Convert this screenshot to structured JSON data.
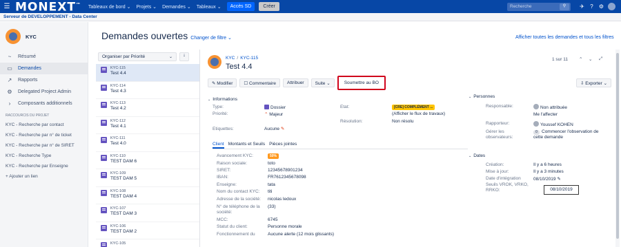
{
  "topbar": {
    "menu_icon": "☰",
    "logo": "MONEXT",
    "nav": [
      "Tableaux de bord ⌄",
      "Projets ⌄",
      "Demandes ⌄",
      "Tableaux ⌄"
    ],
    "acces_sd": "Accès SD",
    "creer": "Créer",
    "search_placeholder": "Recherche",
    "search_icon": "🔍"
  },
  "subbar": {
    "server": "Serveur de DEVELOPPEMENT - Data Center"
  },
  "sidebar": {
    "project_name": "KYC",
    "items": [
      {
        "icon": "~",
        "label": "Résumé"
      },
      {
        "icon": "▭",
        "label": "Demandes"
      },
      {
        "icon": "↗",
        "label": "Rapports"
      },
      {
        "icon": "⚙",
        "label": "Delegated Project Admin"
      },
      {
        "icon": "›",
        "label": "Composants additionnels"
      }
    ],
    "shortcuts_title": "RACCOURCIS DU PROJET",
    "shortcuts": [
      "KYC - Recherche par contact",
      "KYC - Recherche par n° de ticket",
      "KYC - Recherche par n° de SIRET",
      "KYC - Recherche Type",
      "KYC - Recherche par Enseigne"
    ],
    "add_link": "+  Ajouter un lien"
  },
  "header": {
    "title": "Demandes ouvertes",
    "change_filter": "Changer de filtre ⌄",
    "all_requests": "Afficher toutes les demandes et tous les filtres"
  },
  "list": {
    "order_by": "Organiser par Priorité",
    "order_dir": "↓",
    "rows": [
      {
        "key": "KYC-115",
        "title": "Test 4.4"
      },
      {
        "key": "KYC-114",
        "title": "Test 4.3"
      },
      {
        "key": "KYC-113",
        "title": "Test 4.2"
      },
      {
        "key": "KYC-112",
        "title": "Test 4.1"
      },
      {
        "key": "KYC-111",
        "title": "Test 4.0"
      },
      {
        "key": "KYC-110",
        "title": "TEST DAM 6"
      },
      {
        "key": "KYC-109",
        "title": "TEST DAM 5"
      },
      {
        "key": "KYC-108",
        "title": "TEST DAM 4"
      },
      {
        "key": "KYC-107",
        "title": "TEST DAM 3"
      },
      {
        "key": "KYC-106",
        "title": "TEST DAM 2"
      },
      {
        "key": "KYC-105",
        "title": ""
      }
    ]
  },
  "detail": {
    "crumb_project": "KYC",
    "crumb_sep": "/",
    "crumb_key": "KYC-115",
    "title": "Test 4.4",
    "pager": "1 sur 11",
    "toolbar": {
      "modifier": "✎ Modifier",
      "commentaire": "☐ Commentaire",
      "attribuer": "Attribuer",
      "suite": "Suite ⌄",
      "soumettre": "Soumettre au BO"
    },
    "export": "⇩ Exporter ⌄",
    "info": {
      "section": "Informations",
      "type_label": "Type:",
      "type_value": "Dossier",
      "priority_label": "Priorité:",
      "priority_value": "Majeur",
      "labels_label": "Etiquettes:",
      "labels_value": "Aucune",
      "state_label": "Etat:",
      "state_badge": "[CRE] COMPLÉMENT ...",
      "state_flow": "(Afficher le flux de travaux)",
      "resolution_label": "Résolution:",
      "resolution_value": "Non résolu"
    },
    "tabs": [
      "Client",
      "Montants et Seuils",
      "Pièces jointes"
    ],
    "client": [
      {
        "label": "Avancement KYC:",
        "value": "50%"
      },
      {
        "label": "Raison sociale:",
        "value": "toto"
      },
      {
        "label": "SIRET:",
        "value": "12345678901234"
      },
      {
        "label": "IBAN:",
        "value": "FR7612345678098"
      },
      {
        "label": "Enseigne:",
        "value": "tata"
      },
      {
        "label": "Nom du contact KYC:",
        "value": "titi"
      },
      {
        "label": "Adresse de la société:",
        "value": "nicolas ledoux"
      },
      {
        "label": "N° de téléphone de la société:",
        "value": "(33)"
      },
      {
        "label": "MCC:",
        "value": "6745"
      },
      {
        "label": "Statut du client:",
        "value": "Personne morale"
      },
      {
        "label": "Fonctionnement du",
        "value": "Aucune alerte (12 mois glissants)"
      }
    ],
    "people": {
      "section": "Personnes",
      "responsable_label": "Responsable:",
      "responsable_value": "Non attribuée",
      "assign_me": "Me l'affecter",
      "rapporteur_label": "Rapporteur:",
      "rapporteur_value": "Youssef KOHEN",
      "watchers_label": "Gérer les observateurs:",
      "watchers_count": "0",
      "watchers_value": "Commencer l'observation de cette demande"
    },
    "dates": {
      "section": "Dates",
      "creation_label": "Création:",
      "creation_value": "Il y a 6 heures",
      "update_label": "Mise à jour:",
      "update_value": "Il y a 3 minutes",
      "integration_label": "Date d'intégration",
      "integration_value": "08/10/2019",
      "seuils_label": "Seuils VROK, VRKO, RRKO:",
      "tooltip": "08/10/2019"
    }
  }
}
